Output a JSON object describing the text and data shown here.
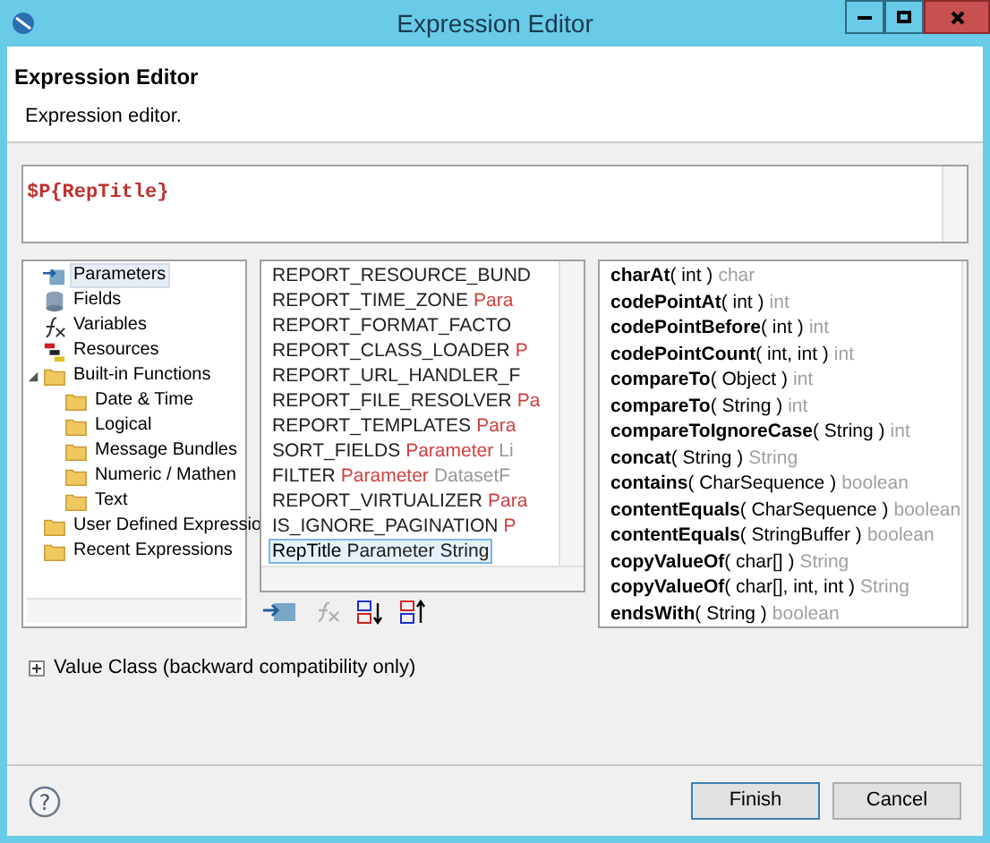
{
  "window": {
    "title": "Expression Editor"
  },
  "header": {
    "title": "Expression Editor",
    "description": "Expression editor."
  },
  "expression": "$P{RepTitle}",
  "tree": [
    {
      "label": "Parameters",
      "kind": "parameters",
      "selected": true
    },
    {
      "label": "Fields",
      "kind": "fields",
      "selected": false
    },
    {
      "label": "Variables",
      "kind": "variables",
      "selected": false
    },
    {
      "label": "Resources",
      "kind": "resources",
      "selected": false
    },
    {
      "label": "Built-in Functions",
      "kind": "folder",
      "selected": false,
      "expanded": true,
      "children": [
        {
          "label": "Date & Time",
          "kind": "folder",
          "selected": false
        },
        {
          "label": "Logical",
          "kind": "folder",
          "selected": false
        },
        {
          "label": "Message Bundles",
          "kind": "folder",
          "selected": false
        },
        {
          "label": "Numeric / Mathen",
          "kind": "folder",
          "selected": false
        },
        {
          "label": "Text",
          "kind": "folder",
          "selected": false
        }
      ]
    },
    {
      "label": "User Defined Expressio",
      "kind": "folder",
      "selected": false
    },
    {
      "label": "Recent Expressions",
      "kind": "folder",
      "selected": false
    }
  ],
  "items": [
    {
      "name": "REPORT_RESOURCE_BUND",
      "selected": false
    },
    {
      "name": "REPORT_TIME_ZONE",
      "type": "Para",
      "selected": false
    },
    {
      "name": "REPORT_FORMAT_FACTO",
      "selected": false
    },
    {
      "name": "REPORT_CLASS_LOADER",
      "type": "P",
      "selected": false
    },
    {
      "name": "REPORT_URL_HANDLER_F",
      "selected": false
    },
    {
      "name": "REPORT_FILE_RESOLVER",
      "type": "Pa",
      "selected": false
    },
    {
      "name": "REPORT_TEMPLATES",
      "type": "Para",
      "selected": false
    },
    {
      "name": "SORT_FIELDS",
      "type": "Parameter",
      "detail": "Li",
      "selected": false
    },
    {
      "name": "FILTER",
      "type": "Parameter",
      "detail": "DatasetF",
      "selected": false
    },
    {
      "name": "REPORT_VIRTUALIZER",
      "type": "Para",
      "selected": false
    },
    {
      "name": "IS_IGNORE_PAGINATION",
      "type": "P",
      "selected": false
    },
    {
      "name": "RepTitle",
      "type": "Parameter",
      "detail": "String",
      "selected": true
    }
  ],
  "methods": [
    {
      "name": "charAt",
      "params": "( int )",
      "returns": "char"
    },
    {
      "name": "codePointAt",
      "params": "( int )",
      "returns": "int"
    },
    {
      "name": "codePointBefore",
      "params": "( int )",
      "returns": "int"
    },
    {
      "name": "codePointCount",
      "params": "( int, int )",
      "returns": "int"
    },
    {
      "name": "compareTo",
      "params": "( Object )",
      "returns": "int"
    },
    {
      "name": "compareTo",
      "params": "( String )",
      "returns": "int"
    },
    {
      "name": "compareToIgnoreCase",
      "params": "( String )",
      "returns": "int"
    },
    {
      "name": "concat",
      "params": "( String )",
      "returns": "String"
    },
    {
      "name": "contains",
      "params": "( CharSequence )",
      "returns": "boolean"
    },
    {
      "name": "contentEquals",
      "params": "( CharSequence )",
      "returns": "boolean"
    },
    {
      "name": "contentEquals",
      "params": "( StringBuffer )",
      "returns": "boolean"
    },
    {
      "name": "copyValueOf",
      "params": "( char[] )",
      "returns": "String"
    },
    {
      "name": "copyValueOf",
      "params": "( char[], int, int )",
      "returns": "String"
    },
    {
      "name": "endsWith",
      "params": "( String )",
      "returns": "boolean"
    }
  ],
  "value_class": {
    "label": "Value Class (backward compatibility only)",
    "expanded": false
  },
  "help": "?",
  "buttons": [
    {
      "label": "Finish",
      "default": true
    },
    {
      "label": "Cancel",
      "default": false
    }
  ]
}
